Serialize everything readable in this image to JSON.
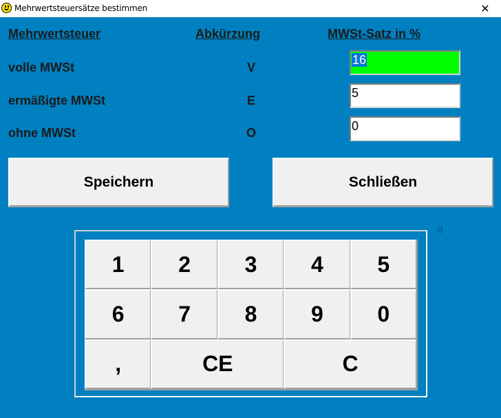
{
  "window": {
    "title": "Mehrwertsteuersätze bestimmen",
    "icon": "smiley-icon",
    "close_label": "✕"
  },
  "headers": {
    "col1": "Mehrwertsteuer",
    "col2": "Abkürzung",
    "col3": "MWSt-Satz in %"
  },
  "rows": [
    {
      "label": "volle MWSt",
      "abbr": "V",
      "value": "16",
      "active": true,
      "selected": true
    },
    {
      "label": "ermäßigte MWSt",
      "abbr": "E",
      "value": "5",
      "active": false,
      "selected": false
    },
    {
      "label": "ohne MWSt",
      "abbr": "O",
      "value": "0",
      "active": false,
      "selected": false
    }
  ],
  "buttons": {
    "save": "Speichern",
    "close": "Schließen"
  },
  "counter": "0",
  "keypad": {
    "keys": [
      "1",
      "2",
      "3",
      "4",
      "5",
      "6",
      "7",
      "8",
      "9",
      "0",
      ",",
      "CE",
      "C"
    ]
  },
  "colors": {
    "background": "#0080C0",
    "active_field": "#00FF00",
    "selection": "#0078D7",
    "button_face": "#F0F0F0"
  }
}
